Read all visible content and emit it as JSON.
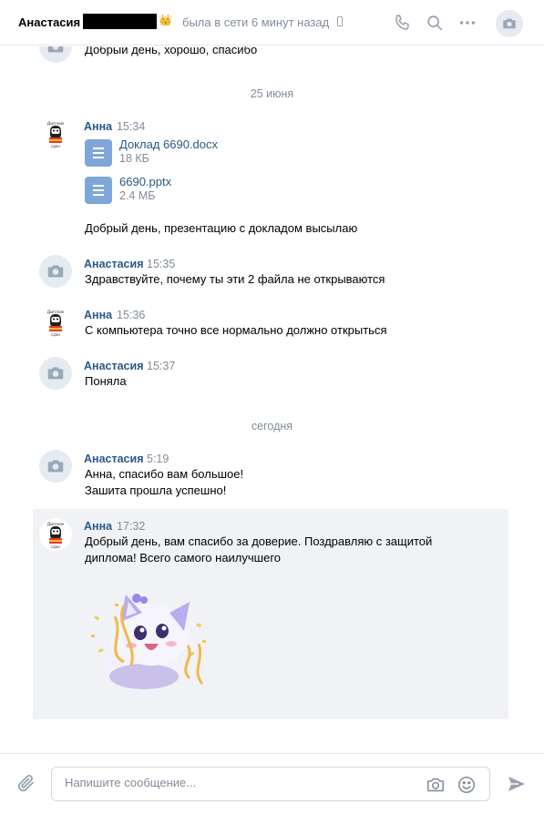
{
  "header": {
    "name": "Анастасия",
    "crown": "👑",
    "status": "была в сети 6 минут назад"
  },
  "messages": {
    "top_partial_text": "Добрый день, хорошо, спасибо",
    "date1": "25 июня",
    "m1": {
      "author": "Анна",
      "time": "15:34",
      "docs": [
        {
          "title": "Доклад 6690.docx",
          "size": "18 КБ"
        },
        {
          "title": "6690.pptx",
          "size": "2.4 МБ"
        }
      ],
      "text": "Добрый день, презентацию с докладом высылаю"
    },
    "m2": {
      "author": "Анастасия",
      "time": "15:35",
      "text": "Здравствуйте, почему ты эти 2 файла не открываются"
    },
    "m3": {
      "author": "Анна",
      "time": "15:36",
      "text": "С компьютера точно все нормально должно открыться"
    },
    "m4": {
      "author": "Анастасия",
      "time": "15:37",
      "text": "Поняла"
    },
    "date2": "сегодня",
    "m5": {
      "author": "Анастасия",
      "time": "5:19",
      "line1": "Анна, спасибо вам большое!",
      "line2": "Зашита прошла успешно!"
    },
    "m6": {
      "author": "Анна",
      "time": "17:32",
      "line1": "Добрый день, вам спасибо за доверие. Поздравляю с защитой",
      "line2": "диплома! Всего самого наилучшего"
    }
  },
  "composer": {
    "placeholder": "Напишите сообщение..."
  },
  "colors": {
    "link": "#2a5885",
    "muted": "#818c99",
    "highlight_bg": "#f0f2f5",
    "doc_icon": "#7fa6d9"
  }
}
